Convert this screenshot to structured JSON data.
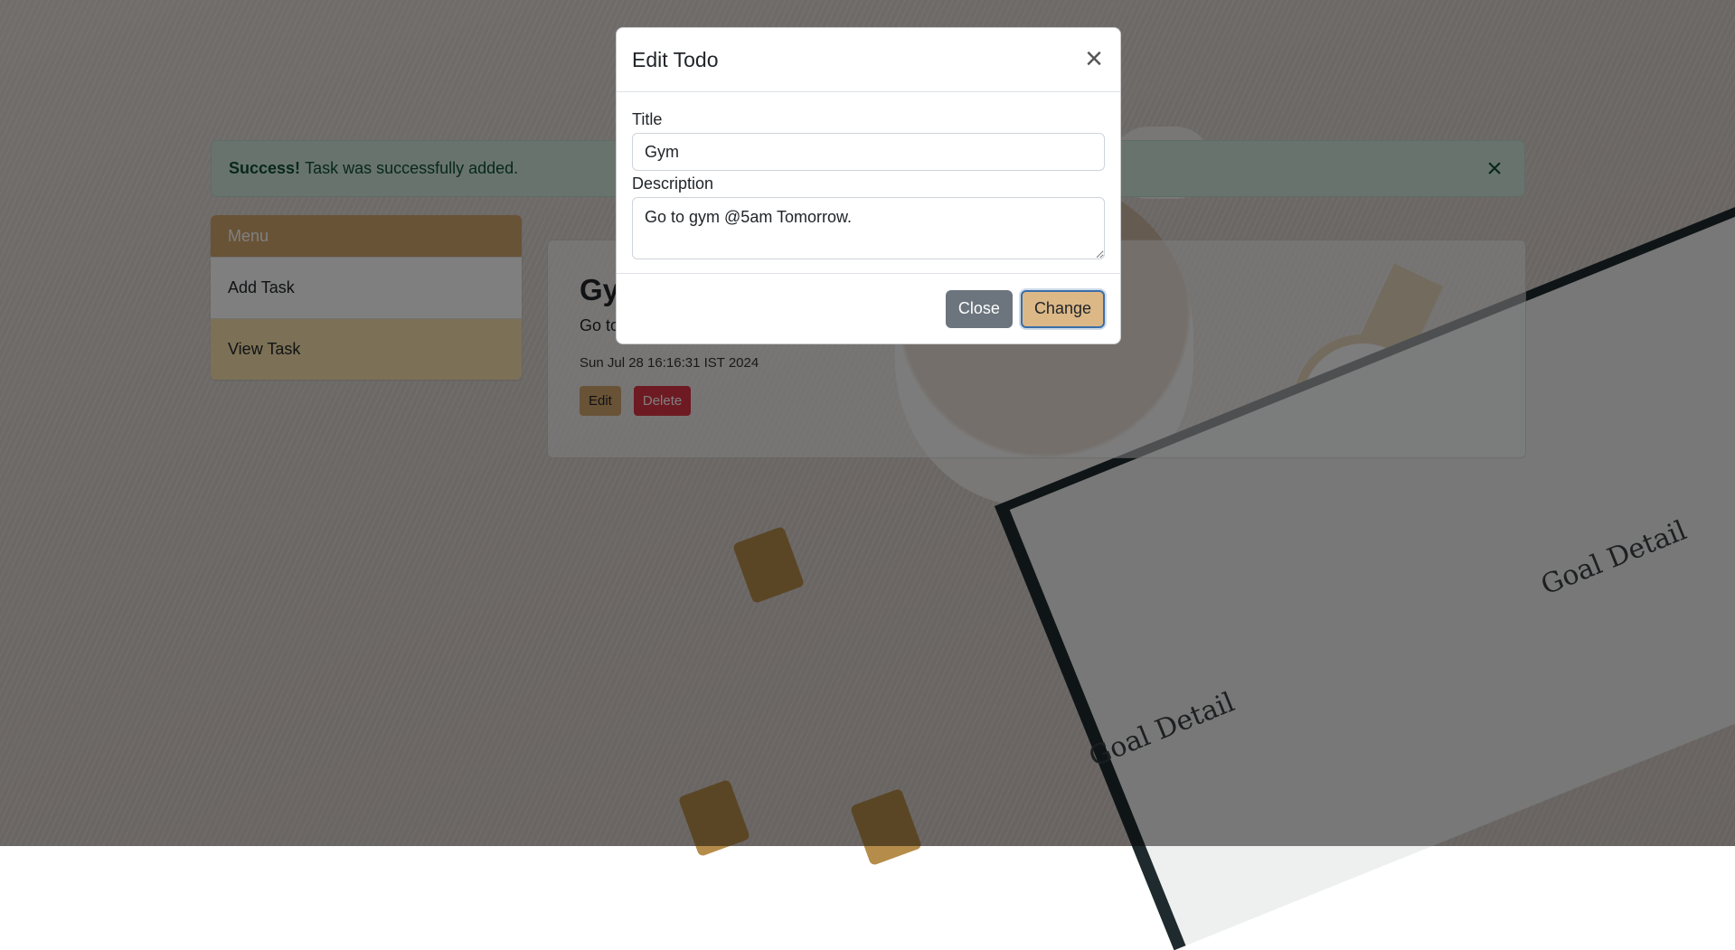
{
  "alert": {
    "strong": "Success!",
    "message": "Task was successfully added."
  },
  "menu": {
    "header": "Menu",
    "items": [
      {
        "label": "Add Task"
      },
      {
        "label": "View Task"
      }
    ]
  },
  "todo": {
    "title": "Gym",
    "description": "Go to gym @5am Tomorrow.",
    "date": "Sun Jul 28 16:16:31 IST 2024",
    "edit_label": "Edit",
    "delete_label": "Delete"
  },
  "modal": {
    "title": "Edit Todo",
    "title_label": "Title",
    "title_value": "Gym",
    "description_label": "Description",
    "description_value": "Go to gym @5am Tomorrow.",
    "close_label": "Close",
    "change_label": "Change"
  },
  "background": {
    "book_text": "Goal Detail"
  },
  "colors": {
    "accent": "#d2a66c",
    "alert_bg": "#d1e7dd",
    "danger": "#dc3545",
    "secondary": "#6c757d"
  }
}
